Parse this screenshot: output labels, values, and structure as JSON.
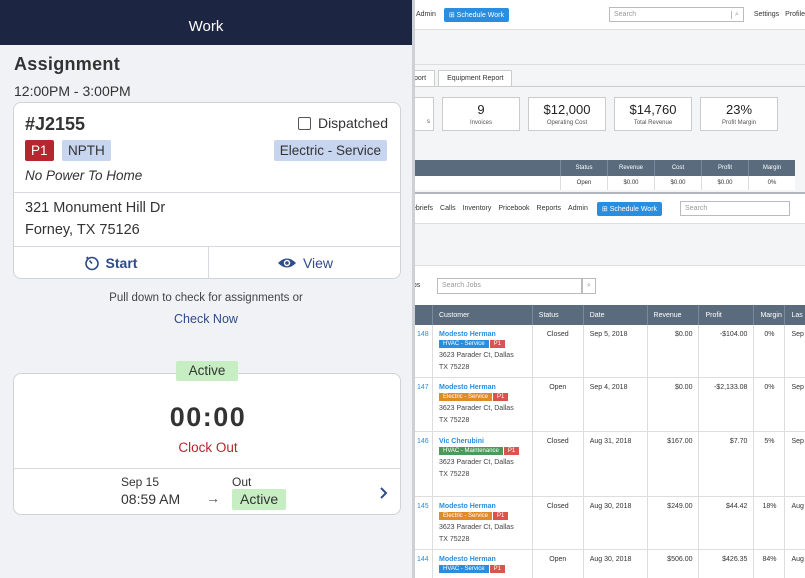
{
  "desktop_top": {
    "nav_admin": "Admin",
    "schedule_button": "Schedule Work",
    "search_placeholder": "Search",
    "settings": "Settings",
    "profile": "Profile",
    "tab_report_partial": "port",
    "tab_equipment": "Equipment Report",
    "stats": [
      {
        "value": "",
        "label": "s"
      },
      {
        "value": "9",
        "label": "Invoices"
      },
      {
        "value": "$12,000",
        "label": "Operating Cost"
      },
      {
        "value": "$14,760",
        "label": "Total Revenue"
      },
      {
        "value": "23%",
        "label": "Profit Margin"
      }
    ],
    "table_headers": [
      "Status",
      "Revenue",
      "Cost",
      "Profit",
      "Margin"
    ],
    "table_row": [
      "Open",
      "$0.00",
      "$0.00",
      "$0.00",
      "0%"
    ]
  },
  "desktop_jobs": {
    "nav": [
      "ebriefs",
      "Calls",
      "Inventory",
      "Pricebook",
      "Reports",
      "Admin"
    ],
    "schedule_button": "Schedule Work",
    "search_placeholder": "Search",
    "jobs_label": "obs",
    "search_jobs_placeholder": "Search Jobs",
    "headers": [
      "",
      "Customer",
      "Status",
      "Date",
      "Revenue",
      "Profit",
      "Margin",
      "Las"
    ],
    "rows": [
      {
        "num": "148",
        "customer": "Modesto Herman",
        "tags": [
          [
            "HVAC - Service",
            "hvac"
          ],
          [
            "P1",
            "p1"
          ]
        ],
        "addr1": "3623 Parader Ct, Dallas",
        "addr2": "TX 75228",
        "status": "Closed",
        "date": "Sep 5, 2018",
        "revenue": "$0.00",
        "profit": "-$104.00",
        "margin": "0%",
        "last": "Sep"
      },
      {
        "num": "147",
        "customer": "Modesto Herman",
        "tags": [
          [
            "Electric - Service",
            "elec"
          ],
          [
            "P1",
            "p1"
          ]
        ],
        "addr1": "3623 Parader Ct, Dallas",
        "addr2": "TX 75228",
        "status": "Open",
        "date": "Sep 4, 2018",
        "revenue": "$0.00",
        "profit": "-$2,133.08",
        "margin": "0%",
        "last": "Sep"
      },
      {
        "num": "146",
        "customer": "Vic Cherubini",
        "tags": [
          [
            "HVAC - Maintenance",
            "maint"
          ],
          [
            "P1",
            "p1"
          ]
        ],
        "addr1": "3623 Parader Ct, Dallas",
        "addr2": "TX 75228",
        "status": "Closed",
        "date": "Aug 31, 2018",
        "revenue": "$167.00",
        "profit": "$7.70",
        "margin": "5%",
        "last": "Sep"
      },
      {
        "num": "145",
        "customer": "Modesto Herman",
        "tags": [
          [
            "Electric - Service",
            "elec"
          ],
          [
            "P1",
            "p1"
          ]
        ],
        "addr1": "3623 Parader Ct, Dallas",
        "addr2": "TX 75228",
        "status": "Closed",
        "date": "Aug 30, 2018",
        "revenue": "$249.00",
        "profit": "$44.42",
        "margin": "18%",
        "last": "Aug"
      },
      {
        "num": "144",
        "customer": "Modesto Herman",
        "tags": [
          [
            "HVAC - Service",
            "hvac"
          ],
          [
            "P1",
            "p1"
          ]
        ],
        "addr1": "",
        "addr2": "",
        "status": "Open",
        "date": "Aug 30, 2018",
        "revenue": "$506.00",
        "profit": "$426.35",
        "margin": "84%",
        "last": "Aug"
      }
    ]
  },
  "mobile": {
    "header_title": "Work",
    "section_title": "Assignment",
    "time_range": "12:00PM - 3:00PM",
    "job_number": "#J2155",
    "dispatched_label": "Dispatched",
    "badge_priority": "P1",
    "badge_npth": "NPTH",
    "badge_type": "Electric - Service",
    "description": "No Power To Home",
    "address_line1": "321 Monument Hill Dr",
    "address_line2": "Forney, TX 75126",
    "start_label": "Start",
    "view_label": "View",
    "pull_text": "Pull down to check for assignments or",
    "check_now": "Check Now",
    "active_label": "Active",
    "timer": "00:00",
    "clock_out": "Clock Out",
    "shift_date": "Sep 15",
    "shift_out": "Out",
    "shift_time": "08:59 AM",
    "shift_arrow": "→",
    "shift_status": "Active"
  },
  "colors": {
    "header_navy": "#1c2541",
    "accent_blue": "#2f4b8a",
    "priority_red": "#b5262f",
    "badge_blue": "#c7d5ee",
    "active_green": "#c7edc3",
    "table_header": "#5a6b7d",
    "link_blue": "#2a8ee0"
  }
}
